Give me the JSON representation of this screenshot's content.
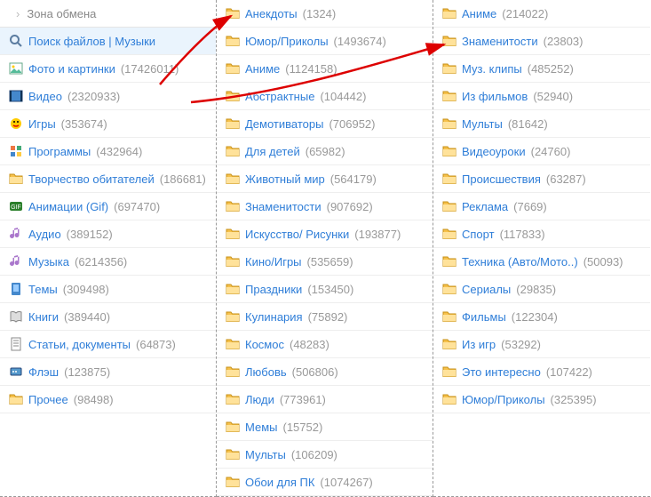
{
  "breadcrumb": {
    "label": "Зона обмена"
  },
  "sidebar": {
    "search_label": "Поиск файлов | Музыки",
    "items": [
      {
        "icon": "photo",
        "label": "Фото и картинки",
        "count": "(17426011)"
      },
      {
        "icon": "video",
        "label": "Видео",
        "count": "(2320933)"
      },
      {
        "icon": "games",
        "label": "Игры",
        "count": "(353674)"
      },
      {
        "icon": "apps",
        "label": "Программы",
        "count": "(432964)"
      },
      {
        "icon": "folder",
        "label": "Творчество обитателей",
        "count": "(186681)"
      },
      {
        "icon": "gif",
        "label": "Анимации (Gif)",
        "count": "(697470)"
      },
      {
        "icon": "audio",
        "label": "Аудио",
        "count": "(389152)"
      },
      {
        "icon": "music",
        "label": "Музыка",
        "count": "(6214356)"
      },
      {
        "icon": "themes",
        "label": "Темы",
        "count": "(309498)"
      },
      {
        "icon": "books",
        "label": "Книги",
        "count": "(389440)"
      },
      {
        "icon": "docs",
        "label": "Статьи, документы",
        "count": "(64873)"
      },
      {
        "icon": "flash",
        "label": "Флэш",
        "count": "(123875)"
      },
      {
        "icon": "folder",
        "label": "Прочее",
        "count": "(98498)"
      }
    ]
  },
  "col2": [
    {
      "label": "Анекдоты",
      "count": "(1324)"
    },
    {
      "label": "Юмор/Приколы",
      "count": "(1493674)"
    },
    {
      "label": "Аниме",
      "count": "(1124158)"
    },
    {
      "label": "Абстрактные",
      "count": "(104442)"
    },
    {
      "label": "Демотиваторы",
      "count": "(706952)"
    },
    {
      "label": "Для детей",
      "count": "(65982)"
    },
    {
      "label": "Животный мир",
      "count": "(564179)"
    },
    {
      "label": "Знаменитости",
      "count": "(907692)"
    },
    {
      "label": "Искусство/ Рисунки",
      "count": "(193877)"
    },
    {
      "label": "Кино/Игры",
      "count": "(535659)"
    },
    {
      "label": "Праздники",
      "count": "(153450)"
    },
    {
      "label": "Кулинария",
      "count": "(75892)"
    },
    {
      "label": "Космос",
      "count": "(48283)"
    },
    {
      "label": "Любовь",
      "count": "(506806)"
    },
    {
      "label": "Люди",
      "count": "(773961)"
    },
    {
      "label": "Мемы",
      "count": "(15752)"
    },
    {
      "label": "Мульты",
      "count": "(106209)"
    },
    {
      "label": "Обои для ПК",
      "count": "(1074267)"
    }
  ],
  "col3": [
    {
      "label": "Аниме",
      "count": "(214022)"
    },
    {
      "label": "Знаменитости",
      "count": "(23803)"
    },
    {
      "label": "Муз. клипы",
      "count": "(485252)"
    },
    {
      "label": "Из фильмов",
      "count": "(52940)"
    },
    {
      "label": "Мульты",
      "count": "(81642)"
    },
    {
      "label": "Видеоуроки",
      "count": "(24760)"
    },
    {
      "label": "Происшествия",
      "count": "(63287)"
    },
    {
      "label": "Реклама",
      "count": "(7669)"
    },
    {
      "label": "Спорт",
      "count": "(117833)"
    },
    {
      "label": "Техника (Авто/Мото..)",
      "count": "(50093)"
    },
    {
      "label": "Сериалы",
      "count": "(29835)"
    },
    {
      "label": "Фильмы",
      "count": "(122304)"
    },
    {
      "label": "Из игр",
      "count": "(53292)"
    },
    {
      "label": "Это интересно",
      "count": "(107422)"
    },
    {
      "label": "Юмор/Приколы",
      "count": "(325395)"
    }
  ]
}
